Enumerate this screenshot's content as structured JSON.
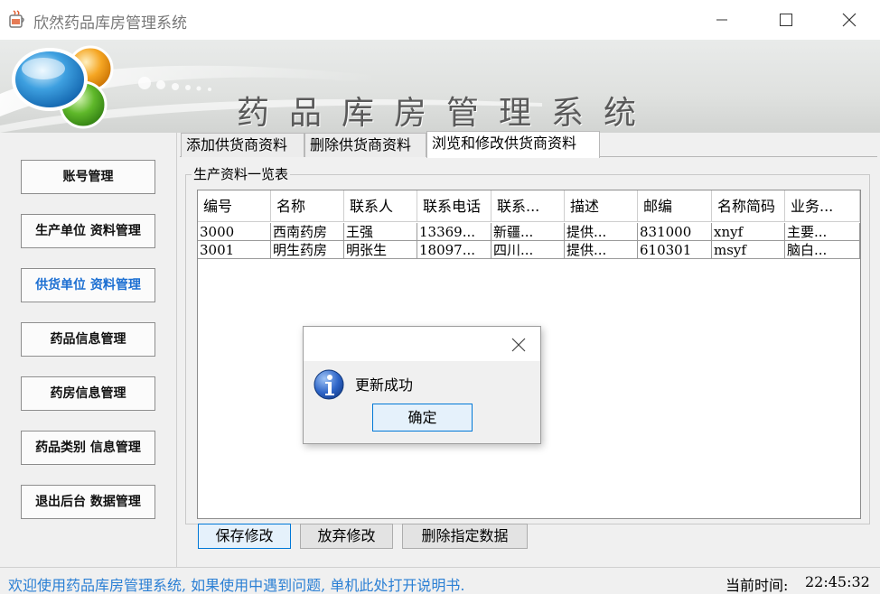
{
  "window": {
    "title": "欣然药品库房管理系统",
    "icon": "java-cup-icon"
  },
  "banner": {
    "title": "药品库房管理系统"
  },
  "sidebar": {
    "items": [
      {
        "label": "账号管理"
      },
      {
        "label": "生产单位 资料管理"
      },
      {
        "label": "供货单位 资料管理",
        "active": true
      },
      {
        "label": "药品信息管理"
      },
      {
        "label": "药房信息管理"
      },
      {
        "label": "药品类别 信息管理"
      },
      {
        "label": "退出后台 数据管理"
      }
    ]
  },
  "tabs": [
    {
      "label": "添加供货商资料"
    },
    {
      "label": "删除供货商资料"
    },
    {
      "label": "浏览和修改供货商资料",
      "selected": true
    }
  ],
  "group": {
    "label": "生产资料一览表"
  },
  "table": {
    "columns": [
      "编号",
      "名称",
      "联系人",
      "联系电话",
      "联系...",
      "描述",
      "邮编",
      "名称简码",
      "业务..."
    ],
    "rows": [
      [
        "3000",
        "西南药房",
        "王强",
        "13369...",
        "新疆...",
        "提供...",
        "831000",
        "xnyf",
        "主要..."
      ],
      [
        "3001",
        "明生药房",
        "明张生",
        "18097...",
        "四川...",
        "提供...",
        "610301",
        "msyf",
        "脑白..."
      ]
    ]
  },
  "buttons": {
    "save": "保存修改",
    "discard": "放弃修改",
    "delete": "删除指定数据"
  },
  "dialog": {
    "message": "更新成功",
    "ok": "确定",
    "icon": "info-icon"
  },
  "status": {
    "message": "欢迎使用药品库房管理系统, 如果使用中遇到问题, 单机此处打开说明书.",
    "time_label": "当前时间:",
    "time": "22:45:32"
  },
  "colors": {
    "accent": "#0078d7",
    "active_nav": "#1c6fd2",
    "status_link": "#2a7fd4"
  }
}
